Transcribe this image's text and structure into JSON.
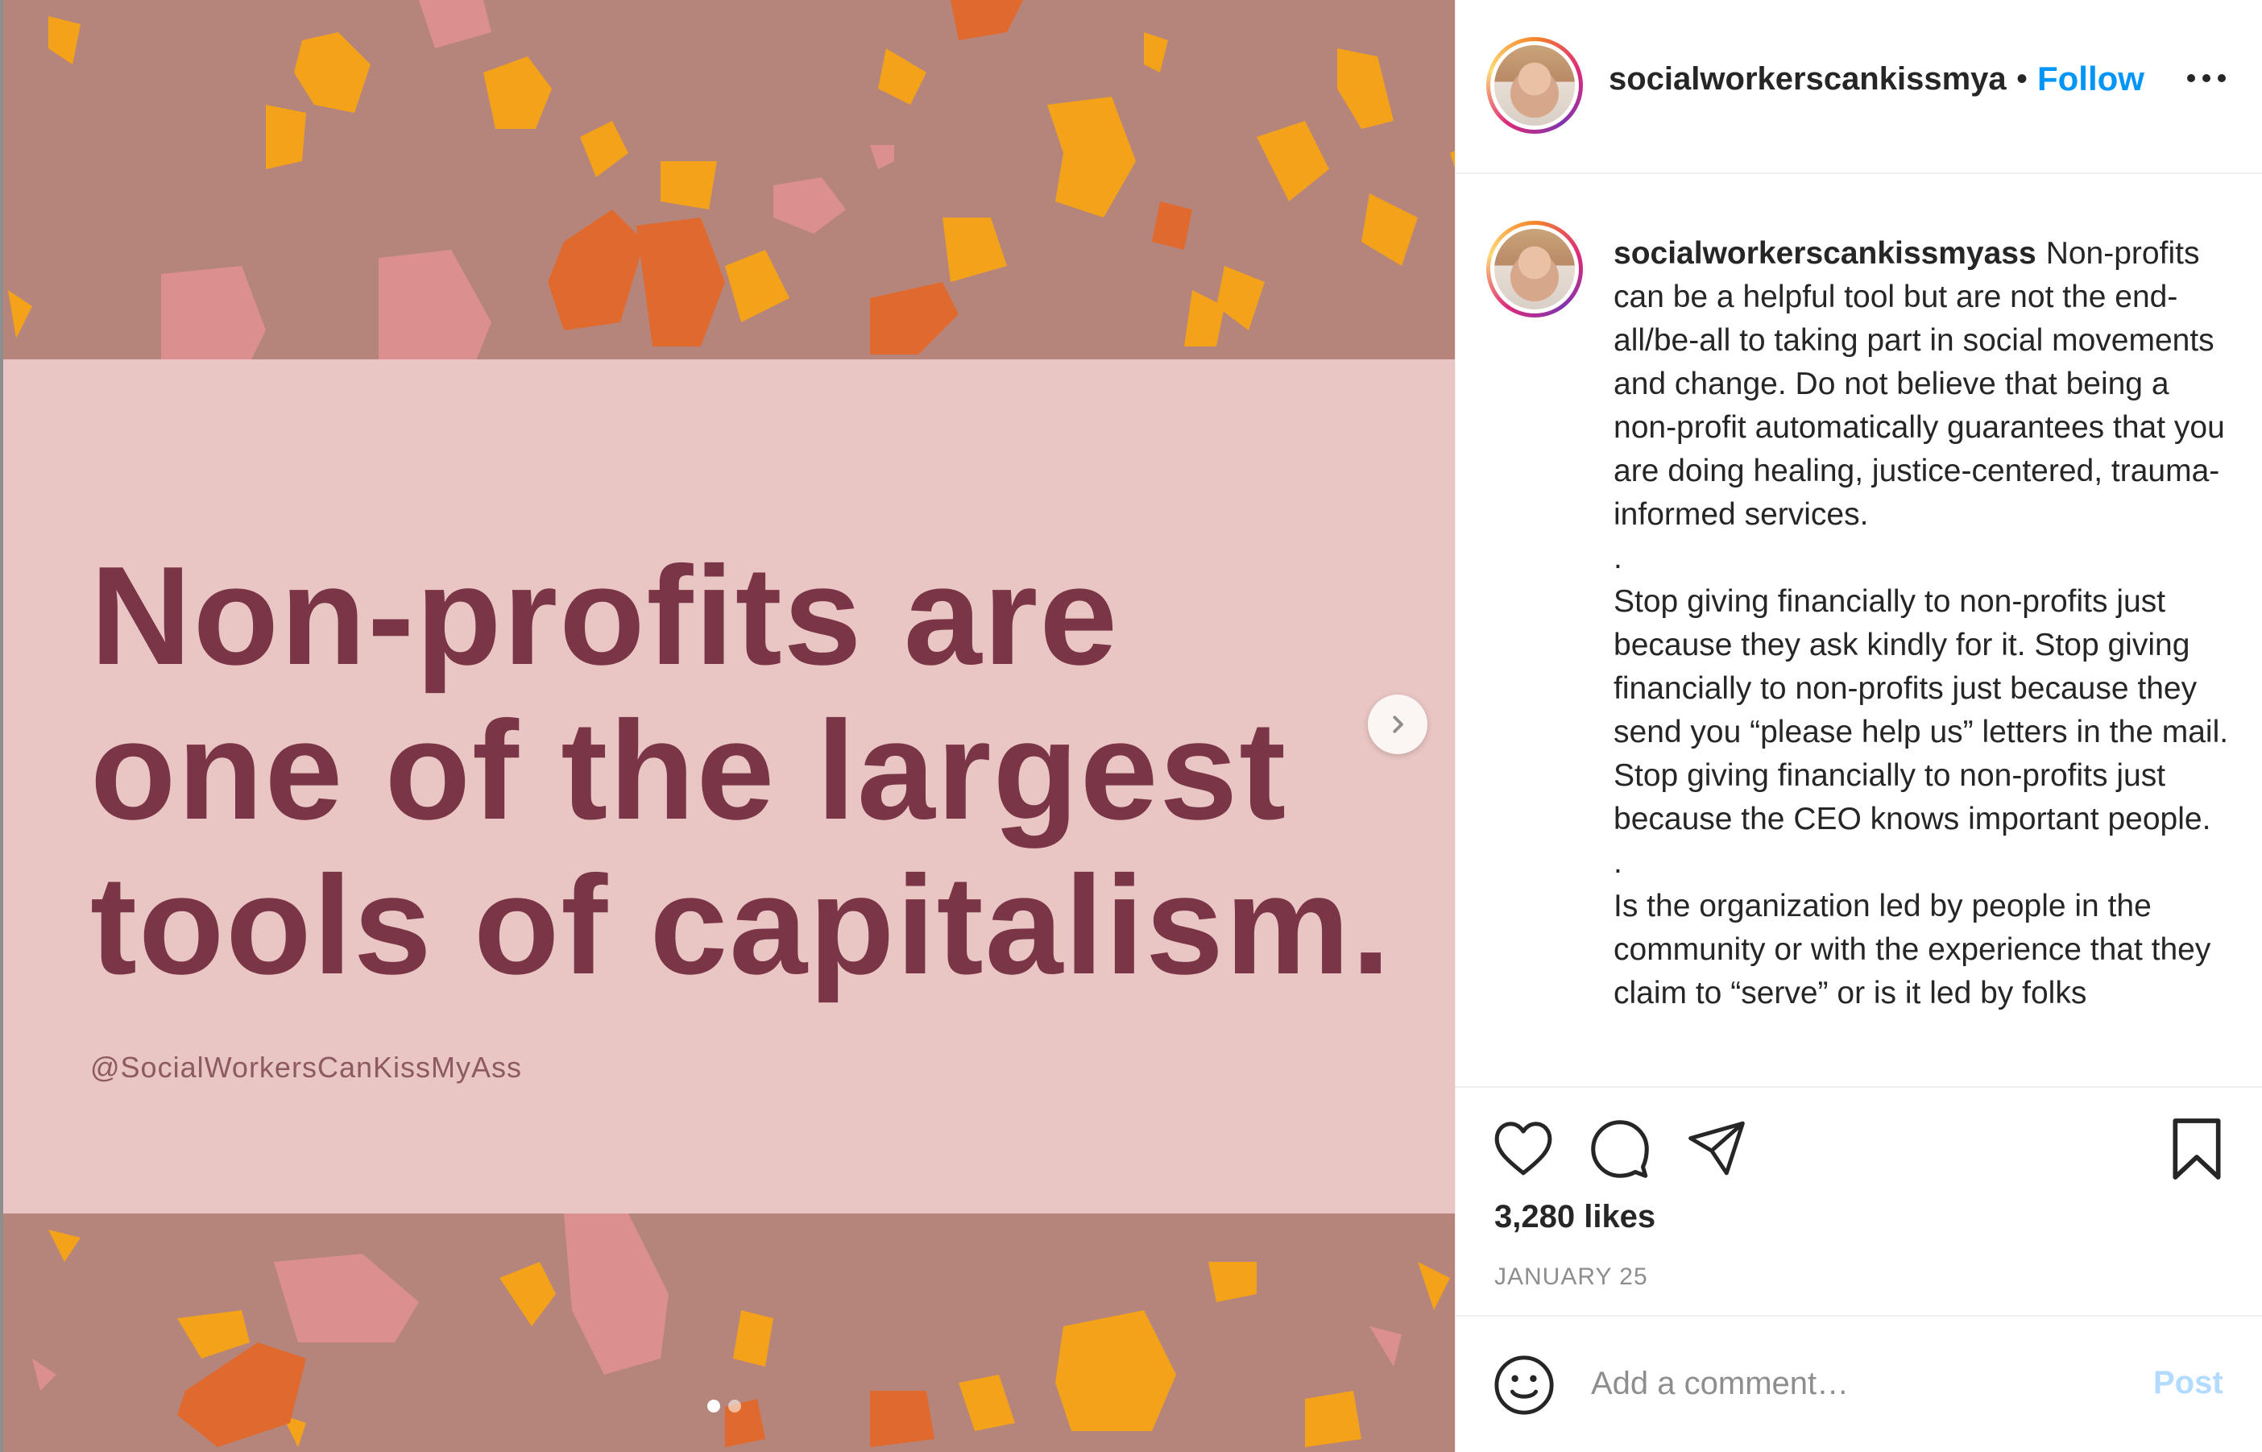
{
  "post": {
    "headline_lines": "Non-profits are\none of the largest\ntools of capitalism.",
    "credit": "@SocialWorkersCanKissMyAss",
    "carousel": {
      "slide_count": 2,
      "active_index": 0
    }
  },
  "header": {
    "username": "socialworkerscankissmya",
    "separator": "•",
    "follow_label": "Follow"
  },
  "caption": {
    "username": "socialworkerscankissmyass",
    "paragraphs": [
      "Non-profits can be a helpful tool but are not the end-all/be-all to taking part in social movements and change. Do not believe that being a non-profit automatically guarantees that you are doing healing, justice-centered, trauma-informed services.",
      ".",
      "Stop giving financially to non-profits just because they ask kindly for it. Stop giving financially to non-profits just because they send you “please help us” letters in the mail. Stop giving financially to non-profits just because the CEO knows important people.",
      ".",
      "Is the organization led by people in the community or with the experience that they claim to “serve” or is it led by folks"
    ]
  },
  "stats": {
    "likes": "3,280 likes",
    "date": "JANUARY 25"
  },
  "comment": {
    "placeholder": "Add a comment…",
    "post_label": "Post"
  },
  "colors": {
    "follow": "#0095f6",
    "post_disabled": "#b3dbff",
    "headline": "#7a3546",
    "card_bg": "#e9c6c3",
    "media_bg": "#b5857b"
  },
  "icons": [
    "next-arrow-icon",
    "more-options-icon",
    "heart-icon",
    "comment-icon",
    "share-icon",
    "bookmark-icon",
    "emoji-icon"
  ]
}
